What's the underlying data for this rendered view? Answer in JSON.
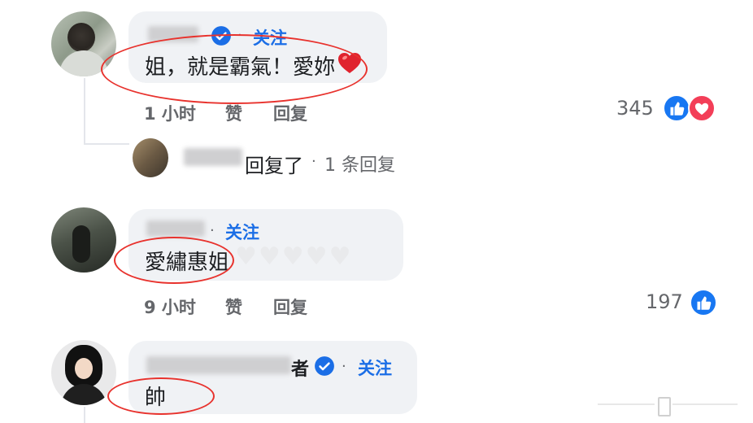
{
  "comments": [
    {
      "follow_label": "关注",
      "text": "姐，就是霸氣！愛妳",
      "time": "1 小时",
      "like_label": "赞",
      "reply_label": "回复",
      "reaction_count": "345",
      "emoji": "❤"
    },
    {
      "follow_label": "关注",
      "text": "愛繡惠姐",
      "time": "9 小时",
      "like_label": "赞",
      "reply_label": "回复",
      "reaction_count": "197"
    },
    {
      "name_tail": "者",
      "follow_label": "关注",
      "text": "帥"
    }
  ],
  "reply_summary": {
    "text": "回复了",
    "count_text": "1 条回复"
  },
  "separator": "·",
  "colors": {
    "accent": "#1b6ee6",
    "annotation": "#e8322d",
    "like": "#1877f2",
    "love": "#f33e58"
  },
  "icons": [
    "verified-badge-icon",
    "like-reaction-icon",
    "love-reaction-icon",
    "heart-emoji-icon"
  ]
}
